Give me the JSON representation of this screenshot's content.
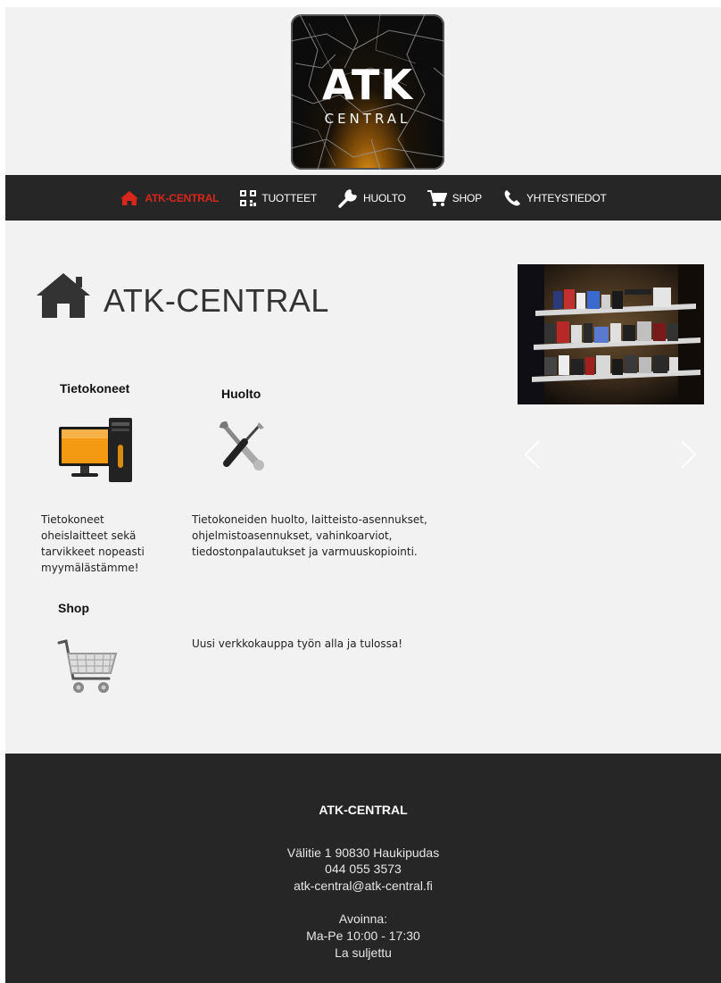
{
  "header": {
    "logo_main": "ATK",
    "logo_sub": "CENTRAL"
  },
  "nav": {
    "items": [
      {
        "label": "ATK-CENTRAL",
        "icon": "home-icon",
        "active": true
      },
      {
        "label": "TUOTTEET",
        "icon": "qr-code-icon",
        "active": false
      },
      {
        "label": "HUOLTO",
        "icon": "wrench-icon",
        "active": false
      },
      {
        "label": "SHOP",
        "icon": "cart-icon",
        "active": false
      },
      {
        "label": "YHTEYSTIEDOT",
        "icon": "phone-icon",
        "active": false
      }
    ]
  },
  "main": {
    "title": "ATK-CENTRAL",
    "title_icon": "home-icon",
    "sections": [
      {
        "heading": "Tietokoneet",
        "icon": "computer-icon",
        "text": "Tietokoneet oheislaitteet sekä tarvikkeet nopeasti myymälästämme!"
      },
      {
        "heading": "Huolto",
        "icon": "tools-icon",
        "text": "Tietokoneiden huolto, laitteisto-asennukset, ohjelmistoasennukset, vahinkoarviot, tiedostonpalautukset ja varmuuskopiointi."
      },
      {
        "heading": "Shop",
        "icon": "shopping-cart-icon",
        "text": "Uusi verkkokauppa työn alla ja tulossa!"
      }
    ],
    "slideshow": {
      "image": "store-shelves-photo",
      "prev_icon": "chevron-left-icon",
      "next_icon": "chevron-right-icon"
    }
  },
  "footer": {
    "title": "ATK-CENTRAL",
    "address": "Välitie 1 90830 Haukipudas",
    "phone": "044 055 3573",
    "email": "atk-central@atk-central.fi",
    "hours_label": "Avoinna:",
    "hours_weekday": "Ma-Pe 10:00 - 17:30",
    "hours_saturday": "La suljettu"
  },
  "colors": {
    "nav_bg": "#262626",
    "active": "#d9261c",
    "page_bg": "#f2f2f2"
  }
}
